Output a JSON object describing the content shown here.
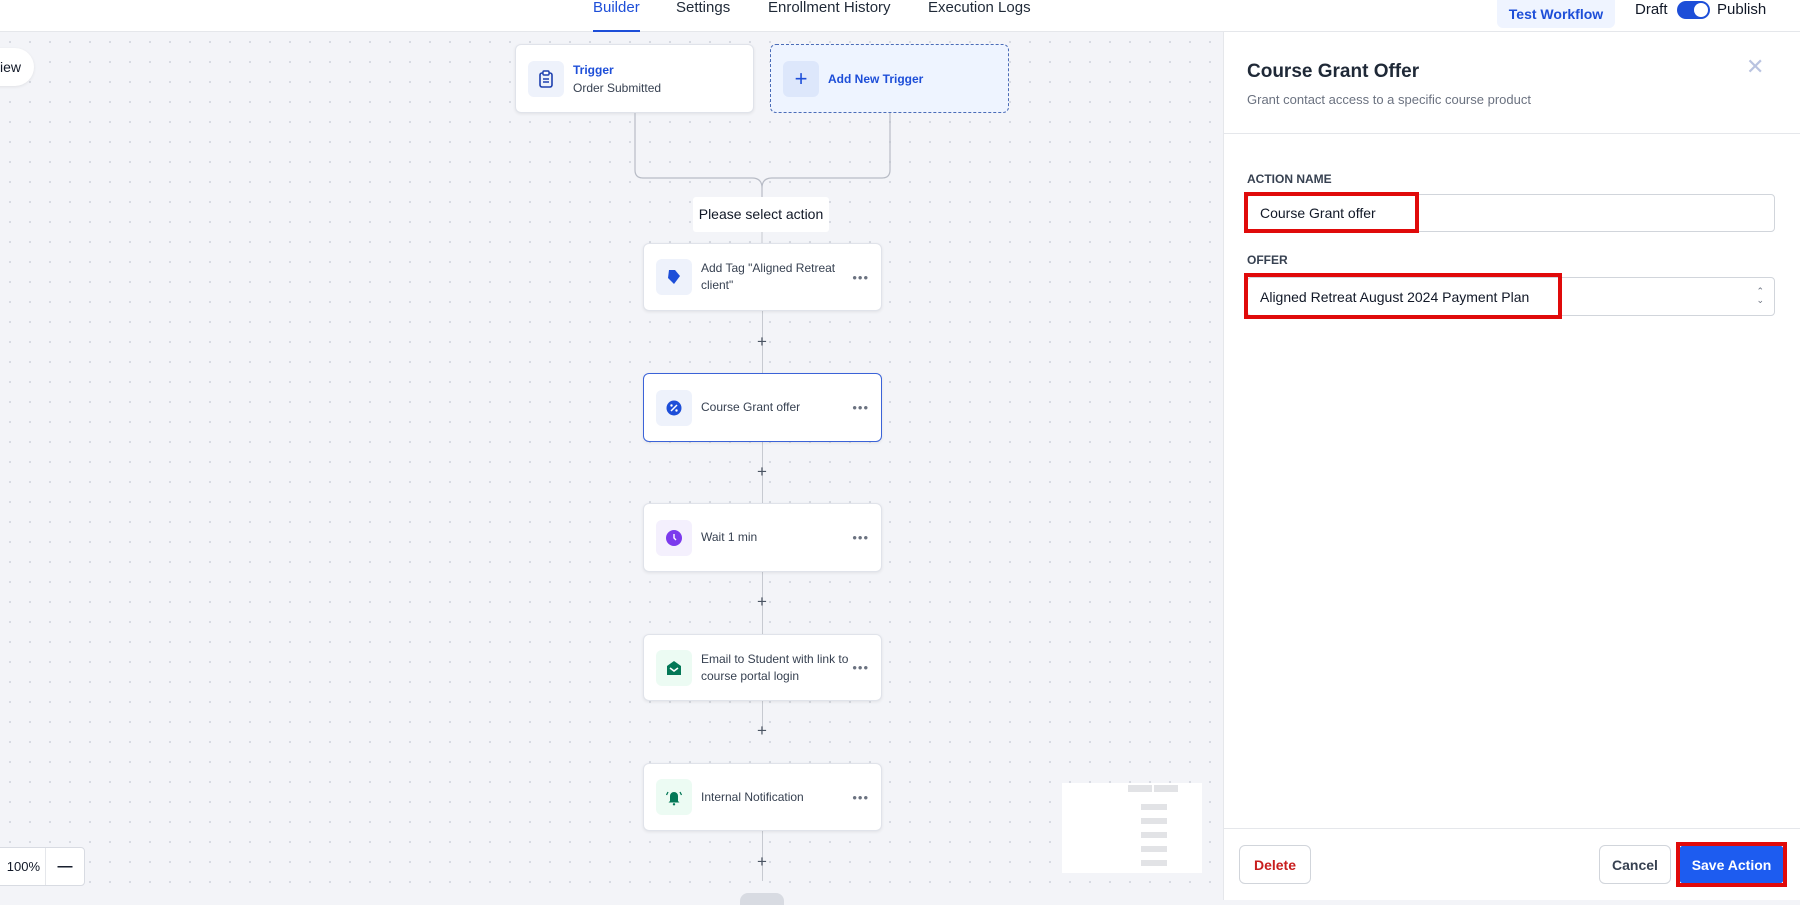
{
  "topbar": {
    "tabs": [
      {
        "label": "Builder",
        "active": true
      },
      {
        "label": "Settings"
      },
      {
        "label": "Enrollment History"
      },
      {
        "label": "Execution Logs"
      }
    ],
    "test_workflow": "Test Workflow",
    "draft": "Draft",
    "publish": "Publish",
    "publish_toggle_on": true
  },
  "canvas": {
    "view_button": "iew",
    "trigger": {
      "title": "Trigger",
      "subtitle": "Order Submitted",
      "icon": "clipboard-icon"
    },
    "add_trigger": "Add New Trigger",
    "select_action": "Please select action",
    "actions": [
      {
        "label": "Add Tag \"Aligned Retreat client\"",
        "icon": "tag-icon",
        "color": "#1d4ed8"
      },
      {
        "label": "Course Grant offer",
        "icon": "percent-badge-icon",
        "color": "#1d4ed8",
        "selected": true
      },
      {
        "label": "Wait 1 min",
        "icon": "clock-icon",
        "color": "#7c3aed"
      },
      {
        "label": "Email to Student with link to course portal login",
        "icon": "email-icon",
        "color": "#047857"
      },
      {
        "label": "Internal Notification",
        "icon": "bell-icon",
        "color": "#047857"
      }
    ],
    "zoom_level": "100%",
    "zoom_out": "—"
  },
  "panel": {
    "title": "Course Grant Offer",
    "subtitle": "Grant contact access to a specific course product",
    "action_name_label": "ACTION NAME",
    "action_name_value": "Course Grant offer",
    "offer_label": "OFFER",
    "offer_value": "Aligned Retreat August 2024 Payment Plan",
    "delete": "Delete",
    "cancel": "Cancel",
    "save": "Save Action"
  },
  "colors": {
    "accent": "#1d4ed8",
    "highlight": "#e00a0a",
    "danger": "#c81e1e"
  }
}
